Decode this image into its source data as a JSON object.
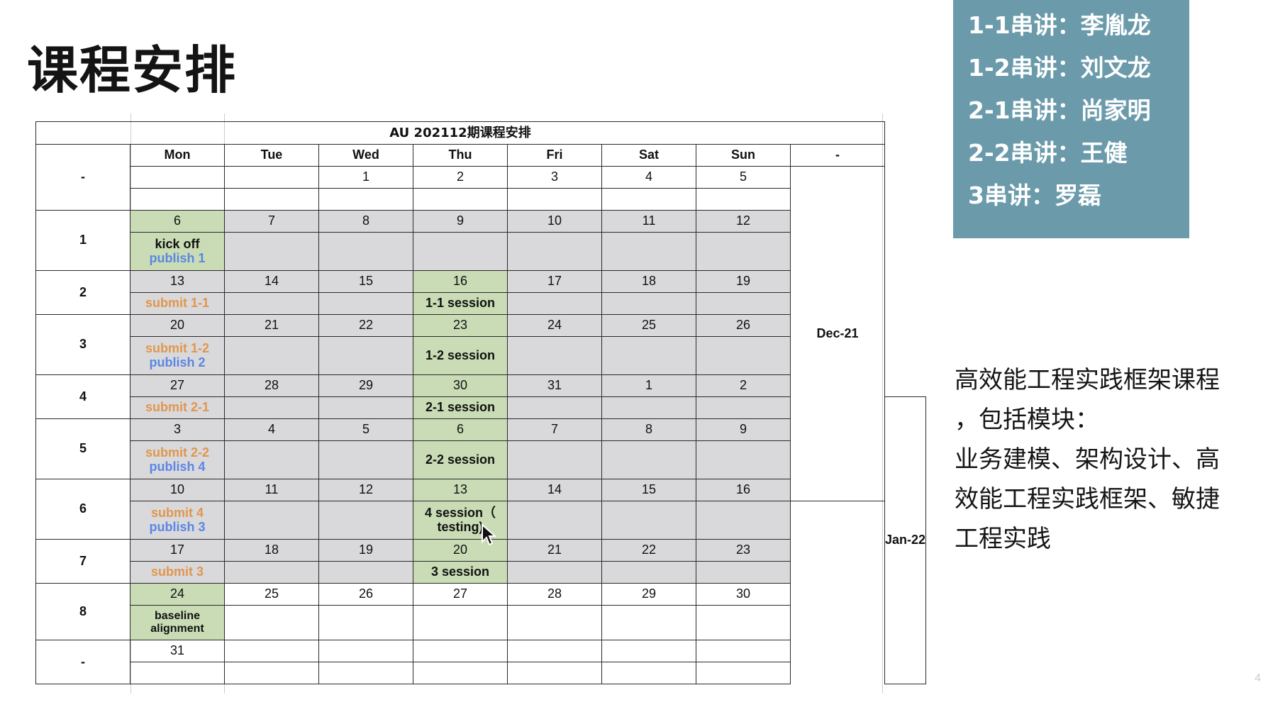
{
  "page": {
    "title": "课程安排",
    "page_number": "4"
  },
  "schedule": {
    "title": "AU 202112期课程安排",
    "corner_label": "-",
    "days": [
      "Mon",
      "Tue",
      "Wed",
      "Thu",
      "Fri",
      "Sat",
      "Sun"
    ],
    "month_header": "-",
    "months": [
      "Dec-21",
      "Jan-22"
    ],
    "weeks": [
      {
        "label": "-",
        "dates": [
          "",
          "",
          "1",
          "2",
          "3",
          "4",
          "5"
        ]
      },
      {
        "label": "1",
        "dates": [
          "6",
          "7",
          "8",
          "9",
          "10",
          "11",
          "12"
        ]
      },
      {
        "label": "2",
        "dates": [
          "13",
          "14",
          "15",
          "16",
          "17",
          "18",
          "19"
        ]
      },
      {
        "label": "3",
        "dates": [
          "20",
          "21",
          "22",
          "23",
          "24",
          "25",
          "26"
        ]
      },
      {
        "label": "4",
        "dates": [
          "27",
          "28",
          "29",
          "30",
          "31",
          "1",
          "2"
        ]
      },
      {
        "label": "5",
        "dates": [
          "3",
          "4",
          "5",
          "6",
          "7",
          "8",
          "9"
        ]
      },
      {
        "label": "6",
        "dates": [
          "10",
          "11",
          "12",
          "13",
          "14",
          "15",
          "16"
        ]
      },
      {
        "label": "7",
        "dates": [
          "17",
          "18",
          "19",
          "20",
          "21",
          "22",
          "23"
        ]
      },
      {
        "label": "8",
        "dates": [
          "24",
          "25",
          "26",
          "27",
          "28",
          "29",
          "30"
        ]
      },
      {
        "label": "-",
        "dates": [
          "31",
          "",
          "",
          "",
          "",
          "",
          ""
        ]
      }
    ],
    "events": {
      "w1_mon_kickoff": "kick off",
      "w1_mon_publish": "publish 1",
      "w2_mon_submit": "submit 1-1",
      "w2_thu_session": "1-1 session",
      "w3_mon_submit": "submit 1-2",
      "w3_mon_publish": "publish 2",
      "w3_thu_session": "1-2 session",
      "w4_mon_submit": "submit 2-1",
      "w4_thu_session": "2-1 session",
      "w5_mon_submit": "submit 2-2",
      "w5_mon_publish": "publish 4",
      "w5_thu_session": "2-2 session",
      "w6_mon_submit": "submit 4",
      "w6_mon_publish": "publish 3",
      "w6_thu_session_1": "4 session（",
      "w6_thu_session_2": "testing)",
      "w7_mon_submit": "submit 3",
      "w7_thu_session": "3 session",
      "w8_mon_1": "baseline",
      "w8_mon_2": "alignment"
    }
  },
  "presenters": [
    "1-1串讲：李胤龙",
    "1-2串讲：刘文龙",
    "2-1串讲：尚家明",
    "2-2串讲：王健",
    "3串讲：罗磊"
  ],
  "description": [
    "高效能工程实践框架课程",
    "，包括模块：",
    "业务建模、架构设计、高",
    "效能工程实践框架、敏捷",
    "工程实践"
  ],
  "colors": {
    "green_cell": "#c9dcb5",
    "gray_cell": "#d9d9db",
    "submit_text": "#e0964e",
    "publish_text": "#5b86e3",
    "presenter_box": "#6b9bab"
  }
}
